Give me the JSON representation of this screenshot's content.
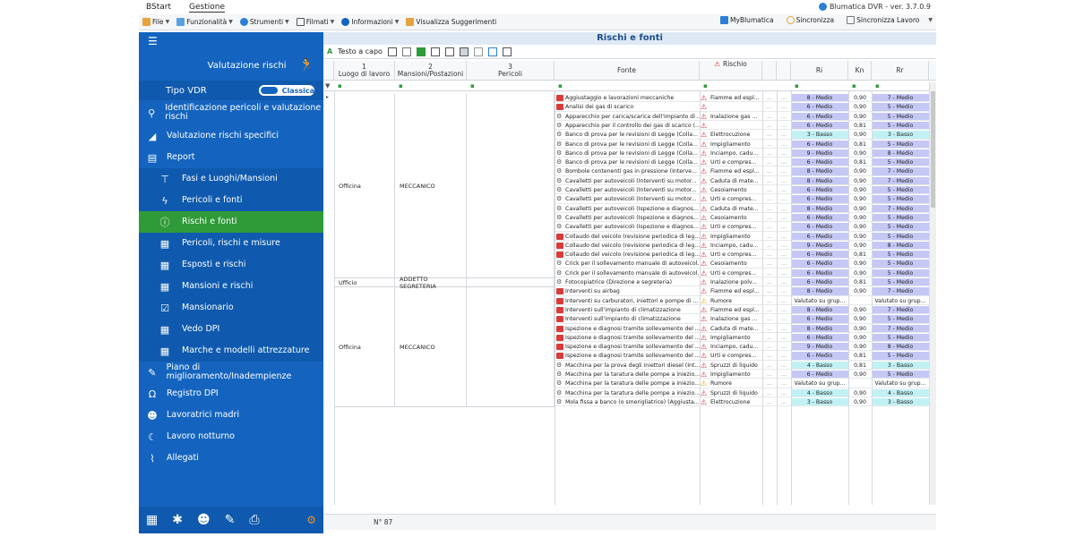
{
  "menubar": {
    "tabs": [
      "BStart",
      "Gestione"
    ],
    "version": "Blumatica DVR - ver. 3.7.0.9"
  },
  "toolbar": {
    "items": [
      "File",
      "Funzionalità",
      "Strumenti",
      "Filmati",
      "Informazioni",
      "Visualizza Suggerimenti"
    ],
    "right": [
      "MyBlumatica",
      "Sincronizza",
      "Sincronizza Lavoro"
    ]
  },
  "sidebar": {
    "header": "Valutazione rischi",
    "tipo_label": "Tipo VDR",
    "tipo_toggle": "Classica",
    "items": [
      {
        "label": "Identificazione pericoli e valutazione rischi",
        "icon": "person-search-icon",
        "level": 0
      },
      {
        "label": "Valutazione rischi specifici",
        "icon": "triangle-icon",
        "level": 0
      },
      {
        "label": "Report",
        "icon": "clipboard-icon",
        "level": 0
      },
      {
        "label": "Fasi e Luoghi/Mansioni",
        "icon": "hierarchy-icon",
        "level": 1
      },
      {
        "label": "Pericoli e fonti",
        "icon": "lightning-icon",
        "level": 1
      },
      {
        "label": "Rischi e fonti",
        "icon": "alert-circle-icon",
        "level": 1,
        "active": true
      },
      {
        "label": "Pericoli, rischi e misure",
        "icon": "report-icon",
        "level": 1
      },
      {
        "label": "Esposti e rischi",
        "icon": "report-icon",
        "level": 1
      },
      {
        "label": "Mansioni e rischi",
        "icon": "report-icon",
        "level": 1
      },
      {
        "label": "Mansionario",
        "icon": "check-box-icon",
        "level": 1
      },
      {
        "label": "Vedo DPI",
        "icon": "report-icon",
        "level": 1
      },
      {
        "label": "Marche e modelli attrezzature",
        "icon": "report-icon",
        "level": 1
      },
      {
        "label": "Piano di miglioramento/Inadempienze",
        "icon": "pencil-icon",
        "level": 0
      },
      {
        "label": "Registro DPI",
        "icon": "headphones-icon",
        "level": 0
      },
      {
        "label": "Lavoratrici madri",
        "icon": "person-icon",
        "level": 0
      },
      {
        "label": "Lavoro notturno",
        "icon": "moon-icon",
        "level": 0
      },
      {
        "label": "Allegati",
        "icon": "paperclip-icon",
        "level": 0
      }
    ]
  },
  "main": {
    "title": "Rischi e fonti",
    "grid_toolbar_label": "Testo a capo",
    "columns": {
      "c1_num": "1",
      "c1": "Luogo di lavoro",
      "c2_num": "2",
      "c2": "Mansioni/Postazioni",
      "c3_num": "3",
      "c3": "Pericoli",
      "fonte": "Fonte",
      "rischio": "Rischio",
      "ri": "Ri",
      "kn": "Kn",
      "rr": "Rr"
    },
    "groups": [
      {
        "luogo": "Officina",
        "mansione": "MECCANICO"
      },
      {
        "luogo": "Ufficio",
        "mansione": "ADDETTO SEGRETERIA"
      },
      {
        "luogo": "Officina",
        "mansione": "MECCANICO"
      }
    ],
    "rows": [
      {
        "fonte": "Aggiustaggio e lavorazioni meccaniche",
        "fi": "red",
        "rischio": "Fiamme ed espl...",
        "w": "r",
        "ri": "8 - Medio",
        "kn": "0,90",
        "rr": "7 - Medio",
        "rib": "m",
        "rrb": "m"
      },
      {
        "fonte": "Analisi dei gas di scarico",
        "fi": "red",
        "rischio": "",
        "w": "r",
        "ri": "6 - Medio",
        "kn": "0,90",
        "rr": "5 - Medio",
        "rib": "m",
        "rrb": "m"
      },
      {
        "fonte": "Apparecchio per carica/scarica dell'impianto di ...",
        "fi": "gear",
        "rischio": "Inalazione gas ...",
        "w": "r",
        "ri": "6 - Medio",
        "kn": "0,90",
        "rr": "5 - Medio",
        "rib": "m",
        "rrb": "m"
      },
      {
        "fonte": "Apparecchio per il controllo dei gas di scarico (...",
        "fi": "gear",
        "rischio": "",
        "w": "r",
        "ri": "6 - Medio",
        "kn": "0,81",
        "rr": "5 - Medio",
        "rib": "m",
        "rrb": "m"
      },
      {
        "fonte": "Banco di prova per le revisioni di Legge (Colla...",
        "fi": "gear",
        "rischio": "Elettrocuzione",
        "w": "r",
        "ri": "3 - Basso",
        "kn": "0,90",
        "rr": "3 - Basso",
        "rib": "b",
        "rrb": "b"
      },
      {
        "fonte": "Banco di prova per le revisioni di Legge (Colla...",
        "fi": "gear",
        "rischio": "Impigliamento",
        "w": "r",
        "ri": "6 - Medio",
        "kn": "0,81",
        "rr": "5 - Medio",
        "rib": "m",
        "rrb": "m"
      },
      {
        "fonte": "Banco di prova per le revisioni di Legge (Colla...",
        "fi": "gear",
        "rischio": "Inciampo, cadu...",
        "w": "r",
        "ri": "9 - Medio",
        "kn": "0,90",
        "rr": "8 - Medio",
        "rib": "m",
        "rrb": "m"
      },
      {
        "fonte": "Banco di prova per le revisioni di Legge (Colla...",
        "fi": "gear",
        "rischio": "Urti e compres...",
        "w": "r",
        "ri": "6 - Medio",
        "kn": "0,81",
        "rr": "5 - Medio",
        "rib": "m",
        "rrb": "m"
      },
      {
        "fonte": "Bombole contenenti gas in pressione (Interve...",
        "fi": "gear",
        "rischio": "Fiamme ed espl...",
        "w": "r",
        "ri": "8 - Medio",
        "kn": "0,90",
        "rr": "7 - Medio",
        "rib": "m",
        "rrb": "m"
      },
      {
        "fonte": "Cavalletti per autoveicoli (Interventi su motor...",
        "fi": "gear",
        "rischio": "Caduta di mate...",
        "w": "r",
        "ri": "8 - Medio",
        "kn": "0,90",
        "rr": "7 - Medio",
        "rib": "m",
        "rrb": "m"
      },
      {
        "fonte": "Cavalletti per autoveicoli (Interventi su motor...",
        "fi": "gear",
        "rischio": "Cesoiamento",
        "w": "r",
        "ri": "6 - Medio",
        "kn": "0,90",
        "rr": "5 - Medio",
        "rib": "m",
        "rrb": "m"
      },
      {
        "fonte": "Cavalletti per autoveicoli (Interventi su motor...",
        "fi": "gear",
        "rischio": "Urti e compres...",
        "w": "r",
        "ri": "6 - Medio",
        "kn": "0,90",
        "rr": "5 - Medio",
        "rib": "m",
        "rrb": "m"
      },
      {
        "fonte": "Cavalletti per autoveicoli (Ispezione e diagnos...",
        "fi": "gear",
        "rischio": "Caduta di mate...",
        "w": "r",
        "ri": "8 - Medio",
        "kn": "0,90",
        "rr": "7 - Medio",
        "rib": "m",
        "rrb": "m"
      },
      {
        "fonte": "Cavalletti per autoveicoli (Ispezione e diagnos...",
        "fi": "gear",
        "rischio": "Cesoiamento",
        "w": "r",
        "ri": "6 - Medio",
        "kn": "0,90",
        "rr": "5 - Medio",
        "rib": "m",
        "rrb": "m"
      },
      {
        "fonte": "Cavalletti per autoveicoli (Ispezione e diagnos...",
        "fi": "gear",
        "rischio": "Urti e compres...",
        "w": "r",
        "ri": "6 - Medio",
        "kn": "0,90",
        "rr": "5 - Medio",
        "rib": "m",
        "rrb": "m"
      },
      {
        "fonte": "Collaudo del veicolo (revisione periodica di leg...",
        "fi": "red",
        "rischio": "Impigliamento",
        "w": "r",
        "ri": "6 - Medio",
        "kn": "0,90",
        "rr": "5 - Medio",
        "rib": "m",
        "rrb": "m"
      },
      {
        "fonte": "Collaudo del veicolo (revisione periodica di leg...",
        "fi": "red",
        "rischio": "Inciampo, cadu...",
        "w": "r",
        "ri": "9 - Medio",
        "kn": "0,90",
        "rr": "8 - Medio",
        "rib": "m",
        "rrb": "m"
      },
      {
        "fonte": "Collaudo del veicolo (revisione periodica di leg...",
        "fi": "red",
        "rischio": "Urti e compres...",
        "w": "r",
        "ri": "6 - Medio",
        "kn": "0,81",
        "rr": "5 - Medio",
        "rib": "m",
        "rrb": "m"
      },
      {
        "fonte": "Crick per il sollevamento manuale di autoveicol...",
        "fi": "gear",
        "rischio": "Cesoiamento",
        "w": "r",
        "ri": "6 - Medio",
        "kn": "0,90",
        "rr": "5 - Medio",
        "rib": "m",
        "rrb": "m"
      },
      {
        "fonte": "Crick per il sollevamento manuale di autoveicol...",
        "fi": "gear",
        "rischio": "Urti e compres...",
        "w": "r",
        "ri": "6 - Medio",
        "kn": "0,90",
        "rr": "5 - Medio",
        "rib": "m",
        "rrb": "m"
      },
      {
        "fonte": "Fotocopiatrice (Direzione e segreteria)",
        "fi": "gear",
        "rischio": "Inalazione polv...",
        "w": "r",
        "ri": "6 - Medio",
        "kn": "0,81",
        "rr": "5 - Medio",
        "rib": "m",
        "rrb": "m"
      },
      {
        "fonte": "Interventi su airbag",
        "fi": "red",
        "rischio": "Fiamme ed espl...",
        "w": "r",
        "ri": "8 - Medio",
        "kn": "0,90",
        "rr": "7 - Medio",
        "rib": "m",
        "rrb": "m"
      },
      {
        "fonte": "Interventi su carburatori, iniettori e pompe di ...",
        "fi": "red",
        "rischio": "Rumore",
        "w": "y",
        "ri": "Valutato su grup...",
        "kn": "",
        "rr": "Valutato su grup...",
        "rib": "g",
        "rrb": "g"
      },
      {
        "fonte": "Interventi sull'impianto di climatizzazione",
        "fi": "red",
        "rischio": "Fiamme ed espl...",
        "w": "r",
        "ri": "8 - Medio",
        "kn": "0,90",
        "rr": "7 - Medio",
        "rib": "m",
        "rrb": "m"
      },
      {
        "fonte": "Interventi sull'impianto di climatizzazione",
        "fi": "red",
        "rischio": "Inalazione gas ...",
        "w": "r",
        "ri": "6 - Medio",
        "kn": "0,90",
        "rr": "5 - Medio",
        "rib": "m",
        "rrb": "m"
      },
      {
        "fonte": "Ispezione e diagnosi tramite sollevamento del ...",
        "fi": "red",
        "rischio": "Caduta di mate...",
        "w": "r",
        "ri": "8 - Medio",
        "kn": "0,90",
        "rr": "7 - Medio",
        "rib": "m",
        "rrb": "m"
      },
      {
        "fonte": "Ispezione e diagnosi tramite sollevamento del ...",
        "fi": "red",
        "rischio": "Impigliamento",
        "w": "r",
        "ri": "6 - Medio",
        "kn": "0,90",
        "rr": "5 - Medio",
        "rib": "m",
        "rrb": "m"
      },
      {
        "fonte": "Ispezione e diagnosi tramite sollevamento del ...",
        "fi": "red",
        "rischio": "Inciampo, cadu...",
        "w": "r",
        "ri": "9 - Medio",
        "kn": "0,90",
        "rr": "8 - Medio",
        "rib": "m",
        "rrb": "m"
      },
      {
        "fonte": "Ispezione e diagnosi tramite sollevamento del ...",
        "fi": "red",
        "rischio": "Urti e compres...",
        "w": "r",
        "ri": "6 - Medio",
        "kn": "0,81",
        "rr": "5 - Medio",
        "rib": "m",
        "rrb": "m"
      },
      {
        "fonte": "Macchina per la prova degli iniettori diesel (Int...",
        "fi": "gear",
        "rischio": "Spruzzi di liquido",
        "w": "r",
        "ri": "4 - Basso",
        "kn": "0,81",
        "rr": "3 - Basso",
        "rib": "b",
        "rrb": "b"
      },
      {
        "fonte": "Macchina per la taratura delle pompe a iniezio...",
        "fi": "gear",
        "rischio": "Impigliamento",
        "w": "r",
        "ri": "6 - Medio",
        "kn": "0,90",
        "rr": "5 - Medio",
        "rib": "m",
        "rrb": "m"
      },
      {
        "fonte": "Macchina per la taratura delle pompe a iniezio...",
        "fi": "gear",
        "rischio": "Rumore",
        "w": "y",
        "ri": "Valutato su grup...",
        "kn": "",
        "rr": "Valutato su grup...",
        "rib": "g",
        "rrb": "g"
      },
      {
        "fonte": "Macchina per la taratura delle pompe a iniezio...",
        "fi": "gear",
        "rischio": "Spruzzi di liquido",
        "w": "r",
        "ri": "4 - Basso",
        "kn": "0,90",
        "rr": "4 - Basso",
        "rib": "b",
        "rrb": "b"
      },
      {
        "fonte": "Mola fissa a banco (o smerigliatrice) (Aggiusta...",
        "fi": "gear",
        "rischio": "Elettrocuzione",
        "w": "r",
        "ri": "3 - Basso",
        "kn": "0,90",
        "rr": "3 - Basso",
        "rib": "b",
        "rrb": "b"
      }
    ],
    "footer_count": "N° 87"
  }
}
